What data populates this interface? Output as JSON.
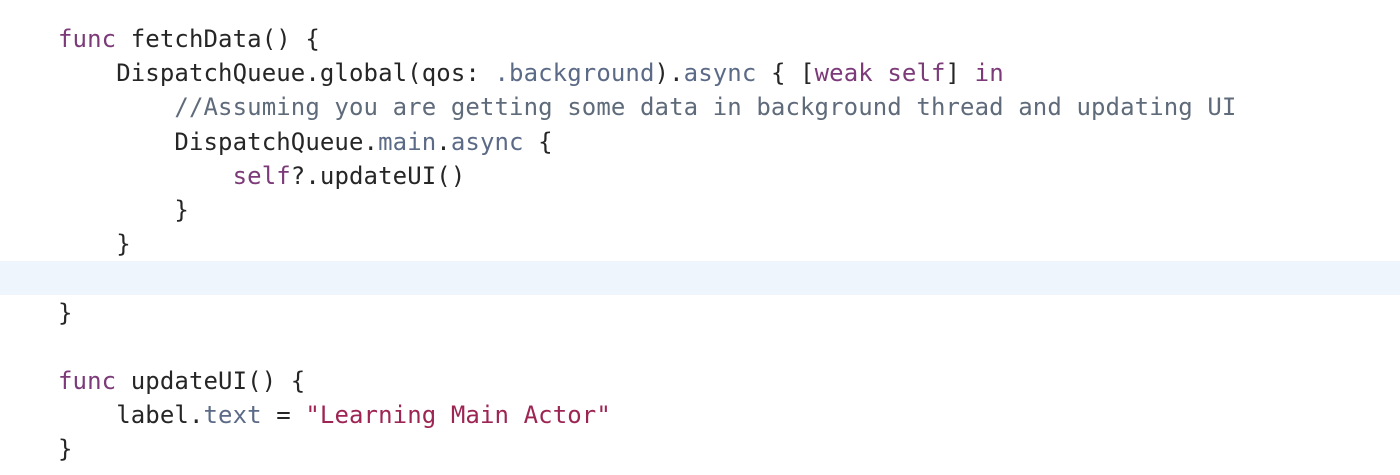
{
  "editor": {
    "current_line_index": 7,
    "lines": [
      [
        {
          "t": "func",
          "c": "kwp"
        },
        {
          "t": " fetchData() {",
          "c": "plain"
        }
      ],
      [
        {
          "t": "    DispatchQueue.global(qos: ",
          "c": "plain"
        },
        {
          "t": ".background",
          "c": "mem"
        },
        {
          "t": ").",
          "c": "plain"
        },
        {
          "t": "async",
          "c": "mem"
        },
        {
          "t": " { [",
          "c": "plain"
        },
        {
          "t": "weak self",
          "c": "kwp"
        },
        {
          "t": "] ",
          "c": "plain"
        },
        {
          "t": "in",
          "c": "kwp"
        }
      ],
      [
        {
          "t": "        //Assuming you are getting some data in background thread and updating UI",
          "c": "cm"
        }
      ],
      [
        {
          "t": "        DispatchQueue.",
          "c": "plain"
        },
        {
          "t": "main",
          "c": "mem"
        },
        {
          "t": ".",
          "c": "plain"
        },
        {
          "t": "async",
          "c": "mem"
        },
        {
          "t": " {",
          "c": "plain"
        }
      ],
      [
        {
          "t": "            ",
          "c": "plain"
        },
        {
          "t": "self",
          "c": "kwp"
        },
        {
          "t": "?.updateUI()",
          "c": "plain"
        }
      ],
      [
        {
          "t": "        }",
          "c": "plain"
        }
      ],
      [
        {
          "t": "    }",
          "c": "plain"
        }
      ],
      [],
      [
        {
          "t": "}",
          "c": "plain"
        }
      ],
      [],
      [
        {
          "t": "func",
          "c": "kwp"
        },
        {
          "t": " updateUI() {",
          "c": "plain"
        }
      ],
      [
        {
          "t": "    label.",
          "c": "plain"
        },
        {
          "t": "text",
          "c": "mem"
        },
        {
          "t": " = ",
          "c": "plain"
        },
        {
          "t": "\"Learning Main Actor\"",
          "c": "str2"
        }
      ],
      [
        {
          "t": "}",
          "c": "plain"
        }
      ]
    ]
  }
}
